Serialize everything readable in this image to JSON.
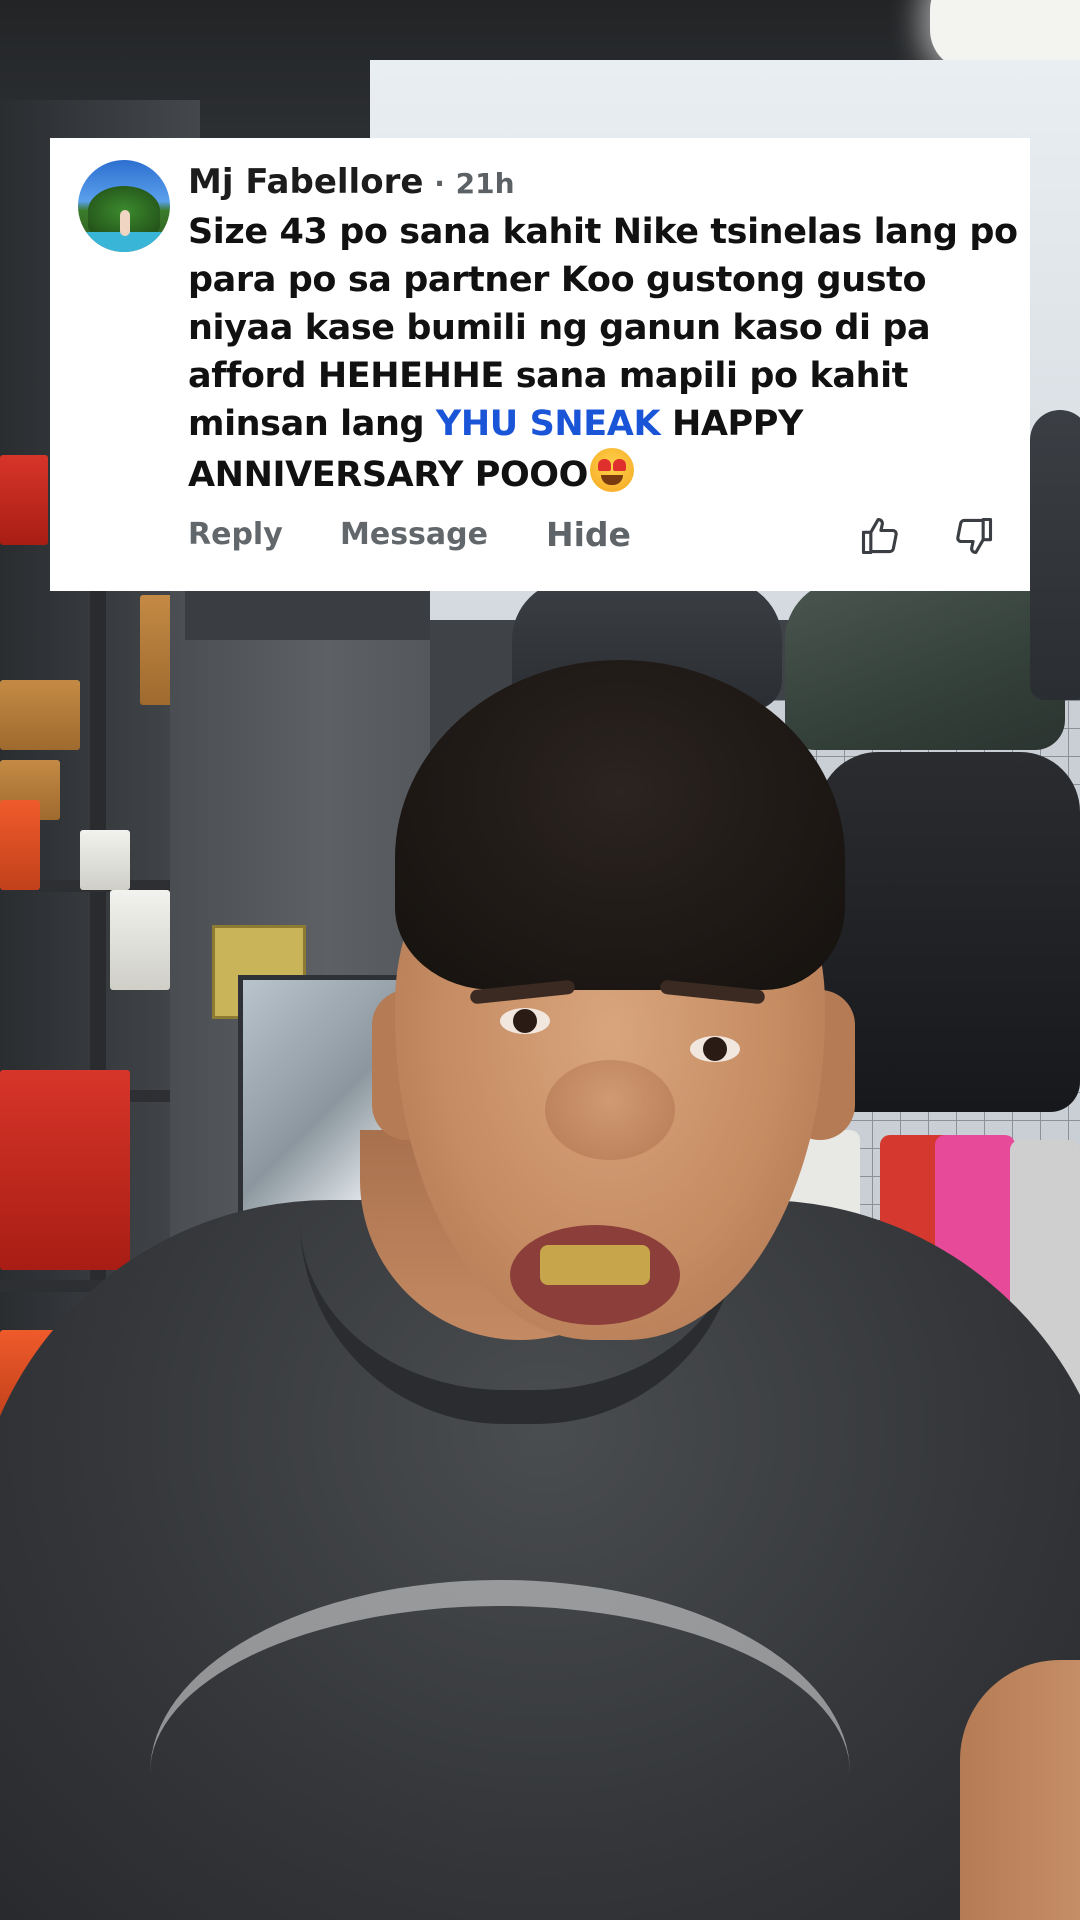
{
  "comment": {
    "author": "Mj Fabellore",
    "separator": "·",
    "time": "21h",
    "text_part1": "Size 43 po sana kahit  Nike tsinelas lang po  para po sa partner Koo gustong gusto niyaa kase bumili ng ganun kaso di pa afford HEHEHHE sana mapili po kahit minsan lang ",
    "mention": "YHU SNEAK",
    "text_part2": " HAPPY ANNIVERSARY POOO",
    "emoji": "smiling-face-with-heart-eyes",
    "actions": {
      "reply": "Reply",
      "message": "Message",
      "hide": "Hide"
    },
    "colors": {
      "mention": "#1a55d8",
      "action_text": "#62676c",
      "card_bg": "#ffffff"
    }
  }
}
